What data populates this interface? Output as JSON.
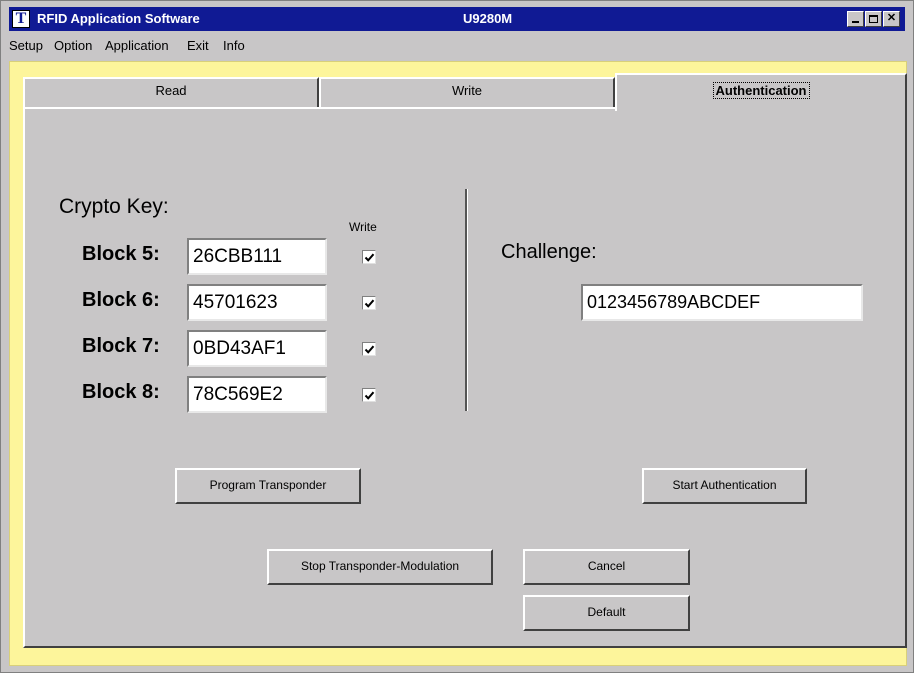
{
  "window": {
    "title": "RFID Application Software",
    "device": "U9280M",
    "icon_letter": "T",
    "controls": [
      "minimize",
      "maximize",
      "close"
    ]
  },
  "menu": [
    "Setup",
    "Option",
    "Application",
    "Exit",
    "Info"
  ],
  "tabs": [
    {
      "label": "Read",
      "active": false
    },
    {
      "label": "Write",
      "active": false
    },
    {
      "label": "Authentication",
      "active": true
    }
  ],
  "crypto": {
    "title": "Crypto Key:",
    "write_col_label": "Write",
    "blocks": [
      {
        "label": "Block 5:",
        "value": "26CBB111",
        "write": true
      },
      {
        "label": "Block 6:",
        "value": "45701623",
        "write": true
      },
      {
        "label": "Block 7:",
        "value": "0BD43AF1",
        "write": true
      },
      {
        "label": "Block 8:",
        "value": "78C569E2",
        "write": true
      }
    ]
  },
  "challenge": {
    "label": "Challenge:",
    "value": "0123456789ABCDEF"
  },
  "buttons": {
    "program": "Program Transponder",
    "start_auth": "Start Authentication",
    "stop_mod": "Stop Transponder-Modulation",
    "cancel": "Cancel",
    "default": "Default"
  },
  "colors": {
    "titlebar": "#101a94",
    "frame": "#fdf59b",
    "face": "#c8c6c7"
  }
}
